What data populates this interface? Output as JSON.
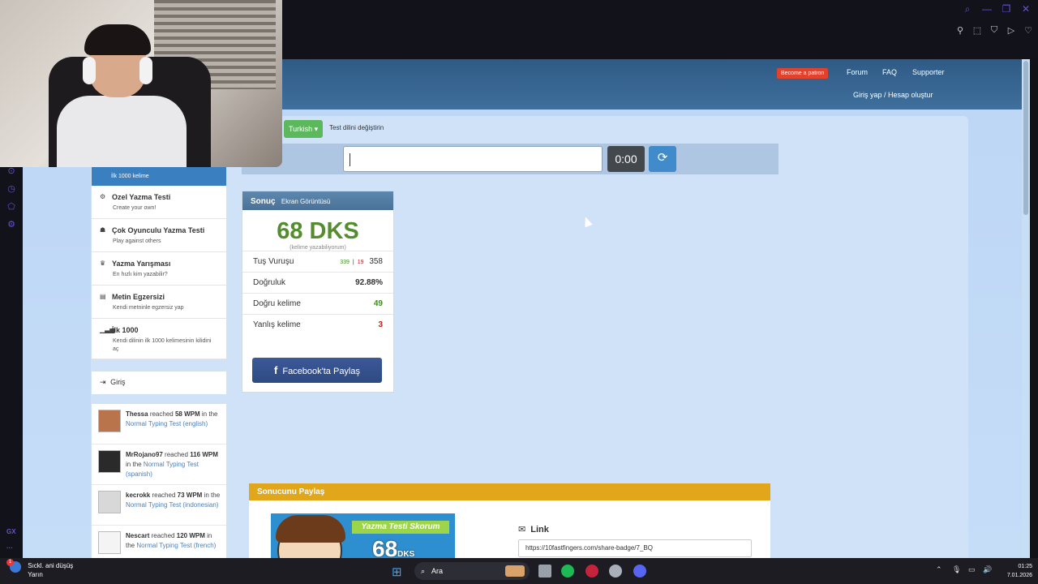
{
  "window": {
    "controls": [
      "search-icon",
      "minimize-icon",
      "restore-icon",
      "close-icon"
    ],
    "extensions": [
      "pin-icon",
      "snapshot-icon",
      "shield-icon",
      "play-icon",
      "heart-icon"
    ]
  },
  "gx": {
    "label": "GX"
  },
  "header": {
    "patron_label": "Become a patron",
    "nav": [
      "Forum",
      "FAQ",
      "Supporter"
    ],
    "login_label": "Giriş yap / Hesap oluştur"
  },
  "language": {
    "selected": "Turkish ▾",
    "change_label": "Test dilini değiştirin"
  },
  "typing": {
    "input_value": "",
    "timer": "0:00",
    "reset_icon": "refresh-icon"
  },
  "sidebar": {
    "top_label": "İlk 1000 kelime",
    "items": [
      {
        "title": "Ozel Yazma Testi",
        "desc": "Create your own!",
        "icon": "cogs-icon"
      },
      {
        "title": "Çok Oyunculu Yazma Testi",
        "desc": "Play against others",
        "icon": "users-icon"
      },
      {
        "title": "Yazma Yarışması",
        "desc": "En hızlı kim yazabilir?",
        "icon": "trophy-icon"
      },
      {
        "title": "Metin Egzersizi",
        "desc": "Kendi metninle egzersiz yap",
        "icon": "file-icon"
      },
      {
        "title": "İlk 1000",
        "desc": "Kendi dilinin ilk 1000 kelimesinin kilidini aç",
        "icon": "signal-icon"
      }
    ],
    "login_label": "Giriş"
  },
  "activity": [
    {
      "user": "Thessa",
      "mid": "reached",
      "wpm": "58 WPM",
      "in": "in",
      "the": "the",
      "test": "Normal Typing Test",
      "lang": "(english)"
    },
    {
      "user": "MrRojano97",
      "mid": "reached",
      "wpm": "116 WPM",
      "in": "in",
      "the": "the",
      "test": "Normal Typing Test",
      "lang": "(spanish)"
    },
    {
      "user": "kecrokk",
      "mid": "reached",
      "wpm": "73 WPM",
      "in": "in",
      "the": "the",
      "test": "Normal Typing Test",
      "lang": "(indonesian)"
    },
    {
      "user": "Nescart",
      "mid": "reached",
      "wpm": "120 WPM",
      "in": "in",
      "the": "the",
      "test": "Normal Typing Test",
      "lang": "(french)"
    }
  ],
  "result": {
    "title": "Sonuç",
    "subtitle": "Ekran Görüntüsü",
    "wpm": "68 DKS",
    "wpm_sub": "(kelime yazabiliyorum)",
    "stats": {
      "keystrokes_label": "Tuş Vuruşu",
      "keystrokes_correct": "339",
      "keystrokes_sep": "|",
      "keystrokes_wrong": "19",
      "keystrokes_total": "358",
      "accuracy_label": "Doğruluk",
      "accuracy": "92.88%",
      "correct_label": "Doğru kelime",
      "correct": "49",
      "wrong_label": "Yanlış kelime",
      "wrong": "3"
    },
    "facebook_label": "Facebook'ta Paylaş"
  },
  "share": {
    "title": "Sonucunu Paylaş",
    "badge_title": "Yazma Testi Skorum",
    "badge_wpm": "68",
    "badge_unit": "DKS",
    "link_label": "Link",
    "link_value": "https://10fastfingers.com/share-badge/7_BQ"
  },
  "taskbar": {
    "weather_line1": "Sıckl. ani düşüş",
    "weather_line2": "Yarın",
    "weather_badge": "1",
    "search_label": "Ara",
    "time": "01:25",
    "date": "7.01.2026"
  },
  "colors": {
    "header": "#2f5a86",
    "page_bg": "#c6ddf8",
    "wpm_green": "#548c2f",
    "error_red": "#c01b1b",
    "facebook": "#3b5998",
    "share_head": "#e1a61a",
    "accent_gx": "#6a4fd6"
  }
}
